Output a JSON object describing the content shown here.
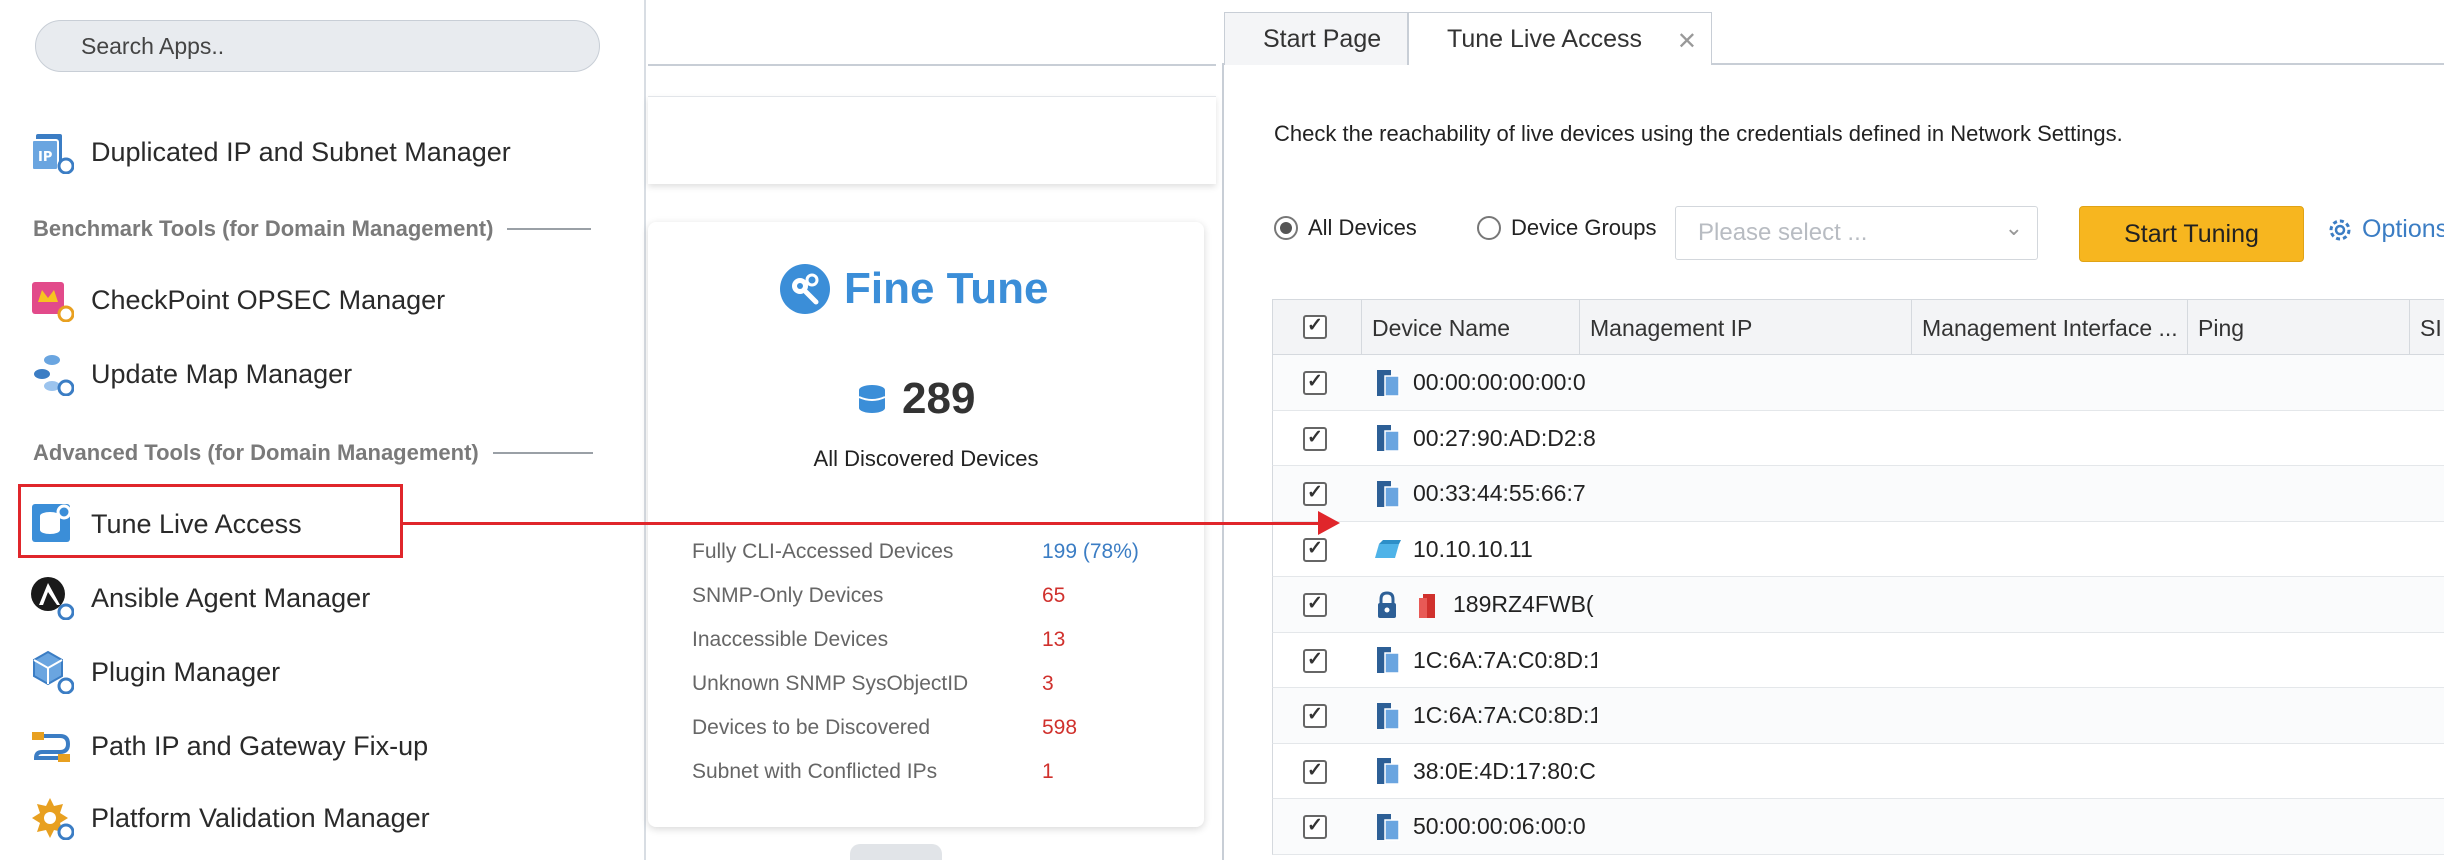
{
  "search": {
    "placeholder": "Search Apps.."
  },
  "apps": {
    "duplicated_ip": "Duplicated IP and Subnet Manager",
    "section_benchmark": "Benchmark Tools (for Domain Management)",
    "checkpoint": "CheckPoint OPSEC Manager",
    "update_map": "Update Map Manager",
    "section_advanced": "Advanced Tools (for Domain Management)",
    "tune_live_access": "Tune Live Access",
    "ansible": "Ansible Agent Manager",
    "plugin": "Plugin Manager",
    "path_ip": "Path IP and Gateway Fix-up",
    "platform_validation": "Platform Validation Manager"
  },
  "dashboard": {
    "title": "Fine Tune",
    "device_count": "289",
    "subtitle": "All Discovered Devices",
    "stats": [
      {
        "label": "Fully CLI-Accessed Devices",
        "value": "199 (78%)"
      },
      {
        "label": "SNMP-Only Devices",
        "value": "65"
      },
      {
        "label": "Inaccessible Devices",
        "value": "13"
      },
      {
        "label": "Unknown SNMP SysObjectID",
        "value": "3"
      },
      {
        "label": "Devices to be Discovered",
        "value": "598"
      },
      {
        "label": "Subnet with Conflicted IPs",
        "value": "1"
      }
    ]
  },
  "tabs": {
    "start_page": "Start Page",
    "tune_live_access": "Tune Live Access",
    "close": "✕"
  },
  "tune": {
    "description": "Check the reachability of live devices using the credentials defined in Network Settings.",
    "radio_all": "All Devices",
    "radio_groups": "Device Groups",
    "select_placeholder": "Please select ...",
    "start_button": "Start Tuning",
    "options": "Options"
  },
  "table": {
    "headers": {
      "device_name": "Device Name",
      "management_ip": "Management IP",
      "management_interface": "Management Interface ...",
      "ping": "Ping",
      "next": "SI"
    },
    "rows": [
      {
        "name": "00:00:00:00:00:0",
        "icon": "switch-icon",
        "checked": true
      },
      {
        "name": "00:27:90:AD:D2:8",
        "icon": "switch-icon",
        "checked": true
      },
      {
        "name": "00:33:44:55:66:7",
        "icon": "switch-icon",
        "checked": true
      },
      {
        "name": "10.10.10.11",
        "icon": "wan-icon",
        "checked": true
      },
      {
        "name": "189RZ4FWB(",
        "icon": "firewall-icon",
        "checked": true,
        "locked": true
      },
      {
        "name": "1C:6A:7A:C0:8D:1",
        "icon": "switch-icon",
        "checked": true
      },
      {
        "name": "1C:6A:7A:C0:8D:1",
        "icon": "switch-icon",
        "checked": true
      },
      {
        "name": "38:0E:4D:17:80:C",
        "icon": "switch-icon",
        "checked": true
      },
      {
        "name": "50:00:00:06:00:0",
        "icon": "switch-icon",
        "checked": true
      }
    ]
  },
  "colors": {
    "accent_blue": "#3b8ed8",
    "link_blue": "#3b7dc4",
    "alert_red": "#d0312d",
    "highlight_red": "#e0262b",
    "button_yellow": "#f7b61f"
  }
}
